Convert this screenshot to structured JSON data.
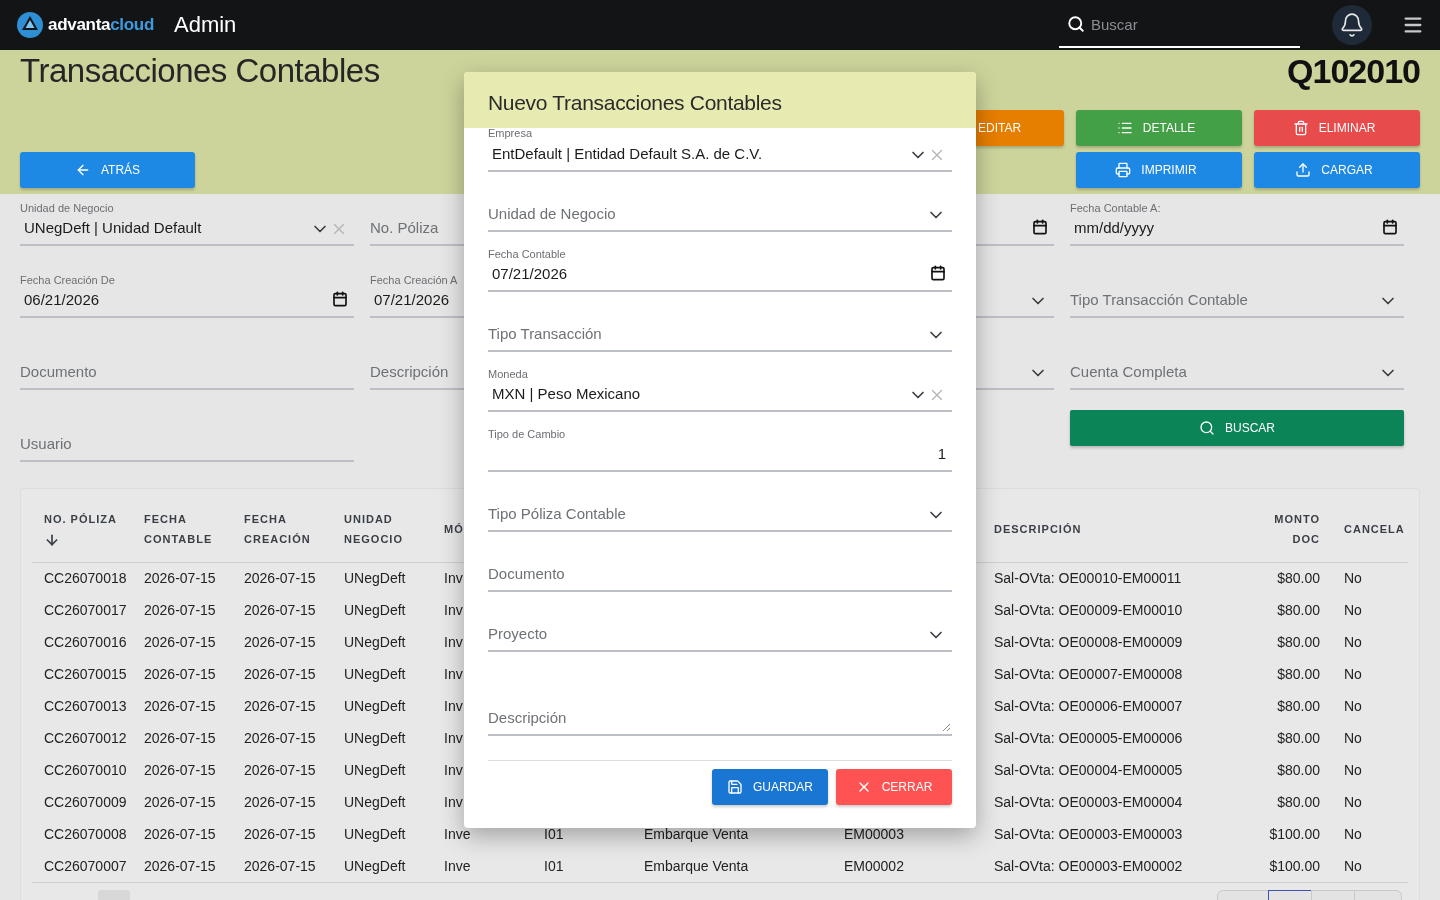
{
  "topbar": {
    "brand_main": "advanta",
    "brand_accent": "cloud",
    "section": "Admin",
    "search": {
      "placeholder": "Buscar"
    }
  },
  "header": {
    "title": "Transacciones Contables",
    "code": "Q102010",
    "back_button": "ATRÁS",
    "action_rows": [
      [
        {
          "label": "EDITAR",
          "kind": "edit"
        },
        {
          "label": "DETALLE",
          "kind": "detail"
        },
        {
          "label": "ELIMINAR",
          "kind": "delete"
        }
      ],
      [
        {
          "label": "IMPRIMIR",
          "kind": "print"
        },
        {
          "label": "CARGAR",
          "kind": "upload"
        }
      ]
    ]
  },
  "filters": [
    {
      "kind": "select",
      "label": "Unidad de Negocio",
      "value": "UNegDeft | Unidad Default",
      "clearable": true
    },
    {
      "kind": "text",
      "label": "No. Póliza"
    },
    {
      "kind": "date"
    },
    {
      "kind": "date",
      "label": "Fecha Contable A:",
      "placeholder": "mm/dd/yyyy"
    },
    {
      "kind": "date",
      "label": "Fecha Creación De",
      "value": "06/21/2026"
    },
    {
      "kind": "text",
      "label": "Fecha Creación A",
      "value": "07/21/2026"
    },
    {
      "kind": "select"
    },
    {
      "kind": "select",
      "label": "Tipo Transacción Contable"
    },
    {
      "kind": "text",
      "label": "Documento"
    },
    {
      "kind": "text",
      "label": "Descripción"
    },
    {
      "kind": "select"
    },
    {
      "kind": "select",
      "label": "Cuenta Completa"
    },
    {
      "kind": "text",
      "label": "Usuario"
    },
    {
      "kind": "empty"
    },
    {
      "kind": "empty"
    },
    {
      "kind": "button",
      "label": "BUSCAR"
    }
  ],
  "table": {
    "columns_left": [
      {
        "label": "NO. PÓLIZA",
        "sorted": true
      },
      {
        "label": "FECHA CONTABLE",
        "sorted": false
      },
      {
        "label": "FECHA CREACIÓN",
        "sorted": false
      },
      {
        "label": "UNIDAD NEGOCIO",
        "sorted": false
      },
      {
        "label": "MÓ",
        "sorted": false
      }
    ],
    "columns_right": [
      {
        "label": "DESCRIPCIÓN",
        "sorted": false
      },
      {
        "label": "MONTO DOC",
        "sorted": false
      },
      {
        "label": "CANCELA",
        "sorted": false
      }
    ],
    "rows": [
      {
        "left": [
          "CC26070018",
          "2026-07-15",
          "2026-07-15",
          "UNegDeft",
          "Inv"
        ],
        "right": [
          "Sal-OVta: OE00010-EM00011",
          "$80.00",
          "No"
        ]
      },
      {
        "left": [
          "CC26070017",
          "2026-07-15",
          "2026-07-15",
          "UNegDeft",
          "Inv"
        ],
        "right": [
          "Sal-OVta: OE00009-EM00010",
          "$80.00",
          "No"
        ]
      },
      {
        "left": [
          "CC26070016",
          "2026-07-15",
          "2026-07-15",
          "UNegDeft",
          "Inv"
        ],
        "right": [
          "Sal-OVta: OE00008-EM00009",
          "$80.00",
          "No"
        ]
      },
      {
        "left": [
          "CC26070015",
          "2026-07-15",
          "2026-07-15",
          "UNegDeft",
          "Inv"
        ],
        "right": [
          "Sal-OVta: OE00007-EM00008",
          "$80.00",
          "No"
        ]
      },
      {
        "left": [
          "CC26070013",
          "2026-07-15",
          "2026-07-15",
          "UNegDeft",
          "Inv"
        ],
        "right": [
          "Sal-OVta: OE00006-EM00007",
          "$80.00",
          "No"
        ]
      },
      {
        "left": [
          "CC26070012",
          "2026-07-15",
          "2026-07-15",
          "UNegDeft",
          "Inv"
        ],
        "right": [
          "Sal-OVta: OE00005-EM00006",
          "$80.00",
          "No"
        ]
      },
      {
        "left": [
          "CC26070010",
          "2026-07-15",
          "2026-07-15",
          "UNegDeft",
          "Inv"
        ],
        "right": [
          "Sal-OVta: OE00004-EM00005",
          "$80.00",
          "No"
        ]
      },
      {
        "left": [
          "CC26070009",
          "2026-07-15",
          "2026-07-15",
          "UNegDeft",
          "Inv"
        ],
        "right": [
          "Sal-OVta: OE00003-EM00004",
          "$80.00",
          "No"
        ]
      },
      {
        "left": [
          "CC26070008",
          "2026-07-15",
          "2026-07-15",
          "UNegDeft",
          "Inve"
        ],
        "middle": [
          "I01",
          "Embarque Venta",
          "EM00003"
        ],
        "right": [
          "Sal-OVta: OE00003-EM00003",
          "$100.00",
          "No"
        ]
      },
      {
        "left": [
          "CC26070007",
          "2026-07-15",
          "2026-07-15",
          "UNegDeft",
          "Inve"
        ],
        "middle": [
          "I01",
          "Embarque Venta",
          "EM00002"
        ],
        "right": [
          "Sal-OVta: OE00003-EM00002",
          "$100.00",
          "No"
        ]
      }
    ]
  },
  "pagination": {
    "pages": [
      {
        "selected": false
      },
      {
        "selected": true
      },
      {
        "selected": false
      },
      {
        "selected": false
      }
    ]
  },
  "modal": {
    "title": "Nuevo Transacciones Contables",
    "fields": [
      {
        "kind": "select",
        "label": "Empresa",
        "value": "EntDefault | Entidad Default S.A. de C.V.",
        "clearable": true
      },
      {
        "kind": "select",
        "label": "Unidad de Negocio"
      },
      {
        "kind": "date",
        "label": "Fecha Contable",
        "value": "07/21/2026"
      },
      {
        "kind": "select",
        "label": "Tipo Transacción"
      },
      {
        "kind": "select",
        "label": "Moneda",
        "value": "MXN | Peso Mexicano",
        "clearable": true
      },
      {
        "kind": "number",
        "label": "Tipo de Cambio",
        "value": "1"
      },
      {
        "kind": "select",
        "label": "Tipo Póliza Contable"
      },
      {
        "kind": "text",
        "label": "Documento"
      },
      {
        "kind": "select",
        "label": "Proyecto"
      },
      {
        "kind": "textarea",
        "label": "Descripción"
      }
    ],
    "buttons": [
      {
        "label": "GUARDAR",
        "kind": "save"
      },
      {
        "label": "CERRAR",
        "kind": "close"
      }
    ]
  }
}
